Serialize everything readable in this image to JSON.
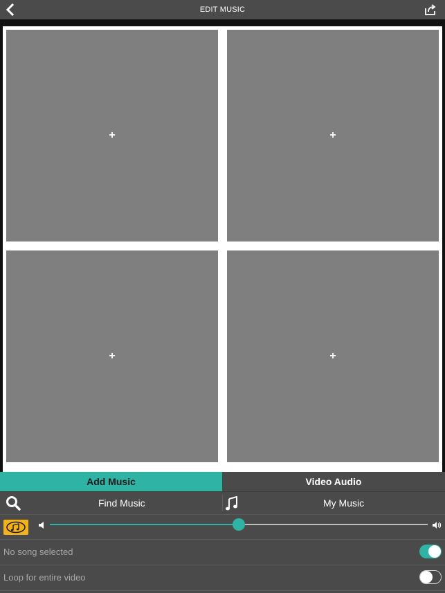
{
  "header": {
    "title": "EDIT MUSIC"
  },
  "collage": {
    "cells": [
      {
        "label": "+"
      },
      {
        "label": "+"
      },
      {
        "label": "+"
      },
      {
        "label": "+"
      }
    ]
  },
  "tabs": [
    {
      "label": "Add Music",
      "active": true
    },
    {
      "label": "Video Audio",
      "active": false
    }
  ],
  "sources": {
    "find_music": "Find Music",
    "my_music": "My Music"
  },
  "volume": {
    "level": 0.5
  },
  "settings": {
    "song_status": {
      "label": "No song selected",
      "toggle_on": true
    },
    "loop": {
      "label": "Loop for entire video",
      "toggle_on": false
    }
  },
  "colors": {
    "accent": "#2fb3a5",
    "badge": "#f3b21a",
    "cell": "#7f7f7f"
  },
  "icons": [
    "back-chevron-icon",
    "share-icon",
    "search-icon",
    "music-note-icon",
    "music-badge-icon",
    "volume-low-icon",
    "volume-high-icon"
  ]
}
